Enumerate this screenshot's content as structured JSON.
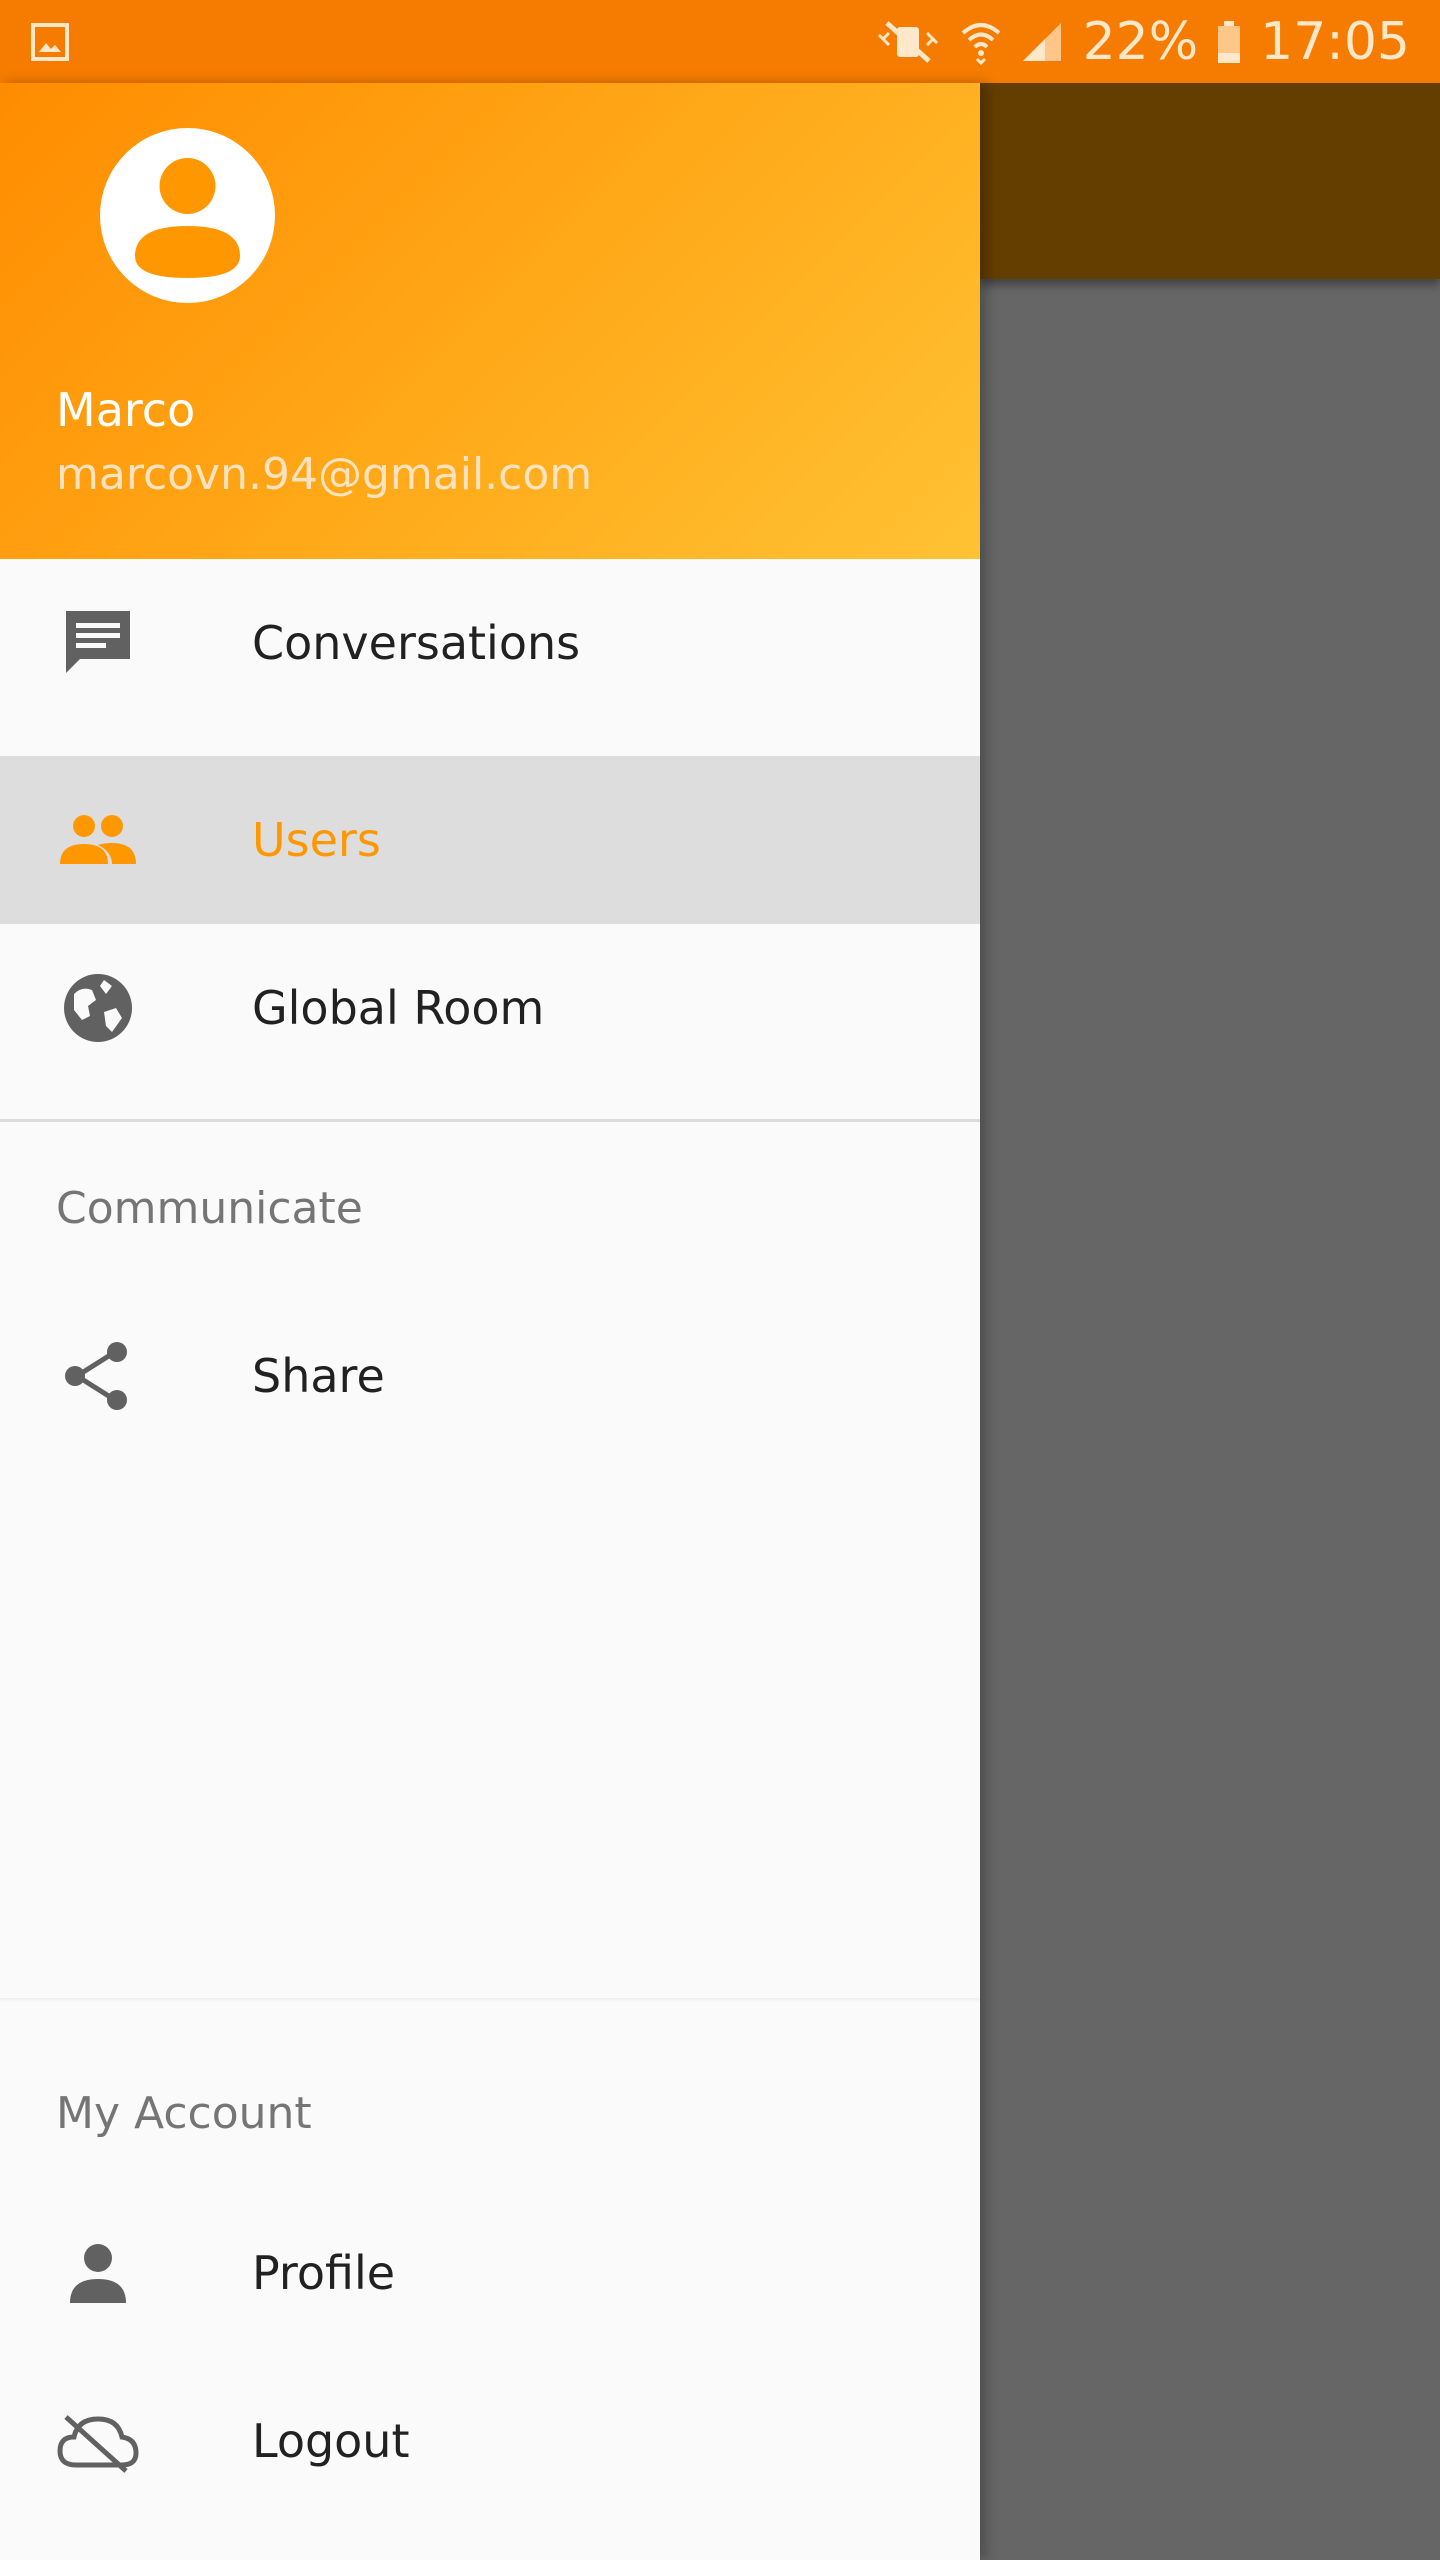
{
  "status_bar": {
    "battery": "22%",
    "time": "17:05",
    "icons": [
      "gallery-icon",
      "mute-vibrate-icon",
      "wifi-icon",
      "signal-icon",
      "battery-icon"
    ]
  },
  "drawer": {
    "header": {
      "name": "Marco",
      "email": "marcovn.94@gmail.com"
    },
    "items": [
      {
        "label": "Conversations",
        "icon": "chat-icon",
        "selected": false
      },
      {
        "label": "Users",
        "icon": "people-icon",
        "selected": true
      },
      {
        "label": "Global Room",
        "icon": "globe-icon",
        "selected": false
      }
    ],
    "communicate": {
      "title": "Communicate",
      "items": [
        {
          "label": "Share",
          "icon": "share-icon"
        }
      ]
    },
    "account": {
      "title": "My Account",
      "items": [
        {
          "label": "Profile",
          "icon": "person-icon"
        },
        {
          "label": "Logout",
          "icon": "cloud-off-icon"
        }
      ]
    }
  },
  "colors": {
    "status_bar": "#F57C00",
    "accent": "#FF9800",
    "selected_bg": "#DDDDDD",
    "icon_gray": "#616161",
    "scrim": "#666666"
  }
}
